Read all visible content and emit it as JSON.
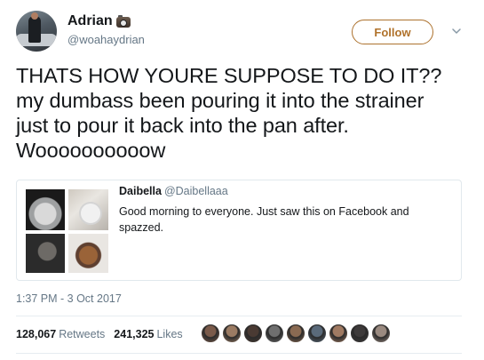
{
  "author": {
    "display_name": "Adrian",
    "handle": "@woahaydrian",
    "avatar_icon": "profile-photo",
    "name_emoji": "camera-icon"
  },
  "follow_button": {
    "label": "Follow",
    "color": "#b0722b"
  },
  "more_menu": {
    "icon": "chevron-down-icon"
  },
  "tweet": {
    "lines": [
      "THATS HOW YOURE SUPPOSE TO DO IT??",
      "my dumbass been pouring it into the strainer",
      "just to pour it back into the pan after.",
      "Woooooooooow"
    ]
  },
  "quoted_tweet": {
    "display_name": "Daibella",
    "handle": "@Daibellaaa",
    "text": "Good morning to everyone. Just saw this on Facebook and spazzed.",
    "media_count": 4
  },
  "timestamp": "1:37 PM - 3 Oct 2017",
  "stats": {
    "retweets_count": "128,067",
    "retweets_label": "Retweets",
    "likes_count": "241,325",
    "likes_label": "Likes"
  },
  "liker_avatar_colors": [
    "#7a5a4a",
    "#9b7b63",
    "#4a3a33",
    "#6f6f6f",
    "#8a6a52",
    "#5a6a7a",
    "#a07a62",
    "#3d3a3a",
    "#9a8a80"
  ]
}
